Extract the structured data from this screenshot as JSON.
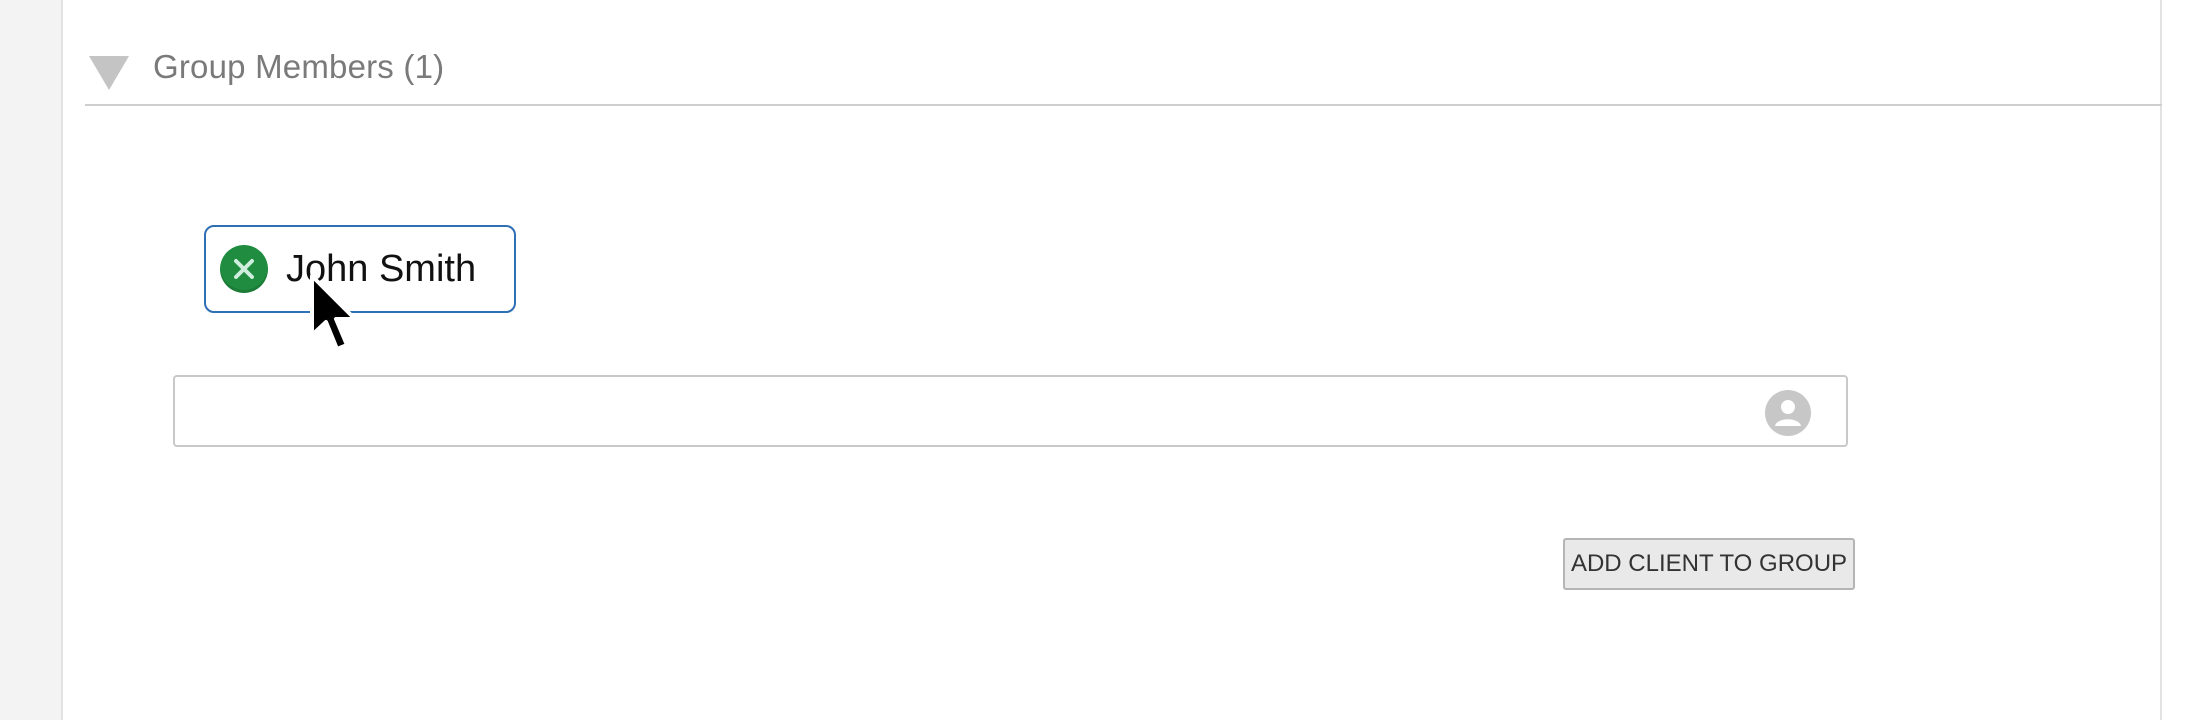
{
  "section": {
    "title": "Group Members (1)",
    "toggle_icon": "triangle-down-icon"
  },
  "members": [
    {
      "name": "John Smith",
      "remove_icon": "close-circle-icon"
    }
  ],
  "search": {
    "value": "",
    "icon": "person-icon"
  },
  "actions": {
    "add_client_label": "ADD CLIENT TO GROUP"
  },
  "colors": {
    "chip_border": "#2f6fb3",
    "remove_green": "#1f8c3f",
    "title_gray": "#7a7a7a"
  }
}
